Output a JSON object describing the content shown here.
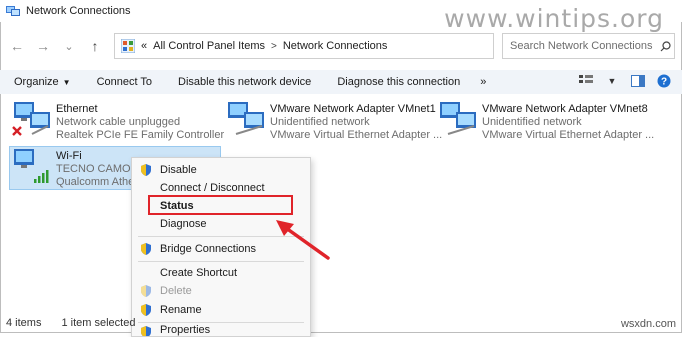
{
  "window": {
    "title": "Network Connections"
  },
  "watermark": "www.wintips.org",
  "nav": {
    "back": "←",
    "forward": "→",
    "recent": "⌄",
    "up": "↑"
  },
  "address": {
    "prefix": "«",
    "crumbs": [
      "All Control Panel Items",
      "Network Connections"
    ],
    "separator": ">"
  },
  "search": {
    "placeholder": "Search Network Connections"
  },
  "commands": {
    "organize": "Organize",
    "connect_to": "Connect To",
    "disable_device": "Disable this network device",
    "diagnose": "Diagnose this connection",
    "more": "»"
  },
  "connections": [
    {
      "name": "Ethernet",
      "status": "Network cable unplugged",
      "device": "Realtek PCIe FE Family Controller"
    },
    {
      "name": "VMware Network Adapter VMnet1",
      "status": "Unidentified network",
      "device": "VMware Virtual Ethernet Adapter ..."
    },
    {
      "name": "VMware Network Adapter VMnet8",
      "status": "Unidentified network",
      "device": "VMware Virtual Ethernet Adapter ..."
    },
    {
      "name": "Wi-Fi",
      "status": "TECNO CAMON",
      "device": "Qualcomm Athe"
    }
  ],
  "context_menu": {
    "disable": "Disable",
    "connect_disconnect": "Connect / Disconnect",
    "status": "Status",
    "diagnose": "Diagnose",
    "bridge": "Bridge Connections",
    "create_shortcut": "Create Shortcut",
    "delete": "Delete",
    "rename": "Rename",
    "properties": "Properties"
  },
  "statusbar": {
    "items": "4 items",
    "selected": "1 item selected"
  },
  "footer_mark": "wsxdn.com",
  "colors": {
    "selection": "#cce4f7",
    "highlight_box": "#e0242a",
    "cmdbar": "#f0f4f9"
  }
}
